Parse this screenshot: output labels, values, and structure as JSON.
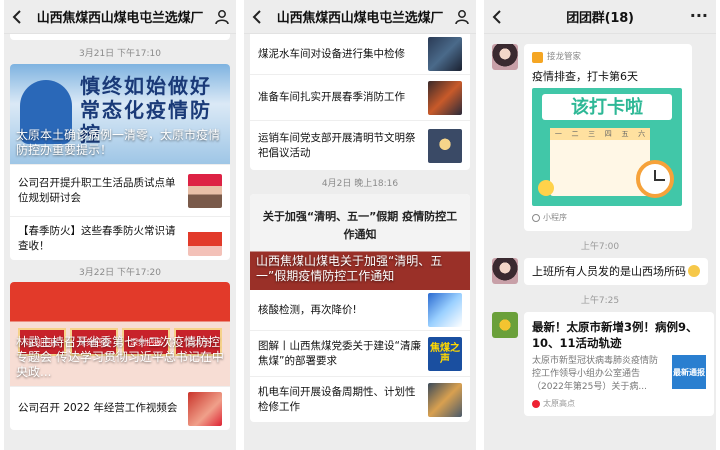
{
  "panel1": {
    "title": "山西焦煤西山煤电屯兰选煤厂",
    "time1": "3月21日 下午17:10",
    "banner1": {
      "headline": "慎终如始做好 常态化疫情防控",
      "caption": "太原本土确诊病例一清零，太原市疫情防控办重要提示！"
    },
    "items1": [
      {
        "text": "公司召开提升职工生活品质试点单位规划研讨会"
      },
      {
        "text": "【春季防火】这些春季防火常识请查收！"
      }
    ],
    "time2": "3月22日 下午17:20",
    "banner2": {
      "tiles": [
        "深刻把握",
        "深刻把握",
        "深刻把握",
        "方大全"
      ],
      "caption": "林武主持召开省委第七十二次疫情防控专题会 传达学习贯彻习近平总书记在中央政..."
    },
    "items2": [
      {
        "text": "公司召开 2022 年经营工作视频会"
      }
    ]
  },
  "panel2": {
    "title": "山西焦煤西山煤电屯兰选煤厂",
    "items1": [
      {
        "text": "煤泥水车间对设备进行集中检修"
      },
      {
        "text": "准备车间扎实开展春季消防工作"
      },
      {
        "text": "运销车间党支部开展清明节文明祭祀倡议活动"
      }
    ],
    "time": "4月2日 晚上18:16",
    "banner": {
      "notice": "关于加强“清明、五一”假期 疫情防控工作通知",
      "caption": "山西焦煤山煤电关于加强“清明、五一”假期疫情防控工作通知"
    },
    "items2": [
      {
        "text": "核酸检测，再次降价!"
      },
      {
        "text": "图解丨山西焦煤党委关于建设“清廉焦煤”的部署要求",
        "thumb": "焦煤之声"
      },
      {
        "text": "机电车间开展设备周期性、计划性检修工作"
      }
    ]
  },
  "panel3": {
    "title": "团团群(18)",
    "msg1": {
      "tag": "接龙管家",
      "text": "疫情排查，打卡第6天",
      "image_title": "该打卡啦",
      "weekdays": [
        "一",
        "二",
        "三",
        "四",
        "五",
        "六"
      ],
      "mini": "小程序"
    },
    "time1": "上午7:00",
    "msg2": {
      "text": "上班所有人员发的是山西场所码"
    },
    "time2": "上午7:25",
    "msg3": {
      "title": "最新！太原市新增3例！病例9、10、11活动轨迹",
      "desc": "太原市新型冠状病毒肺炎疫情防控工作领导小组办公室通告（2022年第25号）关于病...",
      "thumb": "最新通报",
      "source": "太原高点"
    }
  },
  "colors": {
    "bg": "#ededed",
    "accent": "#41c7a8",
    "red": "#e23a2a"
  }
}
